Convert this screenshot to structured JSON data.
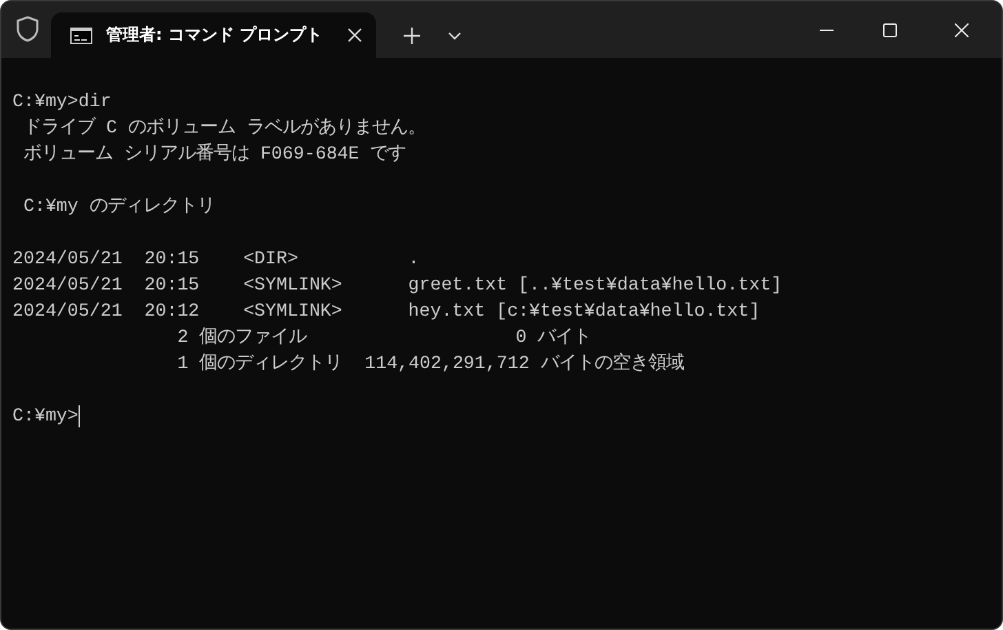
{
  "tab": {
    "title": "管理者: コマンド プロンプト",
    "selected": true
  },
  "console": {
    "lines": [
      {
        "kind": "blank"
      },
      {
        "kind": "text",
        "text": "C:¥my>dir"
      },
      {
        "kind": "text",
        "text": " ドライブ C のボリューム ラベルがありません。"
      },
      {
        "kind": "text",
        "text": " ボリューム シリアル番号は F069-684E です"
      },
      {
        "kind": "blank"
      },
      {
        "kind": "text",
        "text": " C:¥my のディレクトリ"
      },
      {
        "kind": "blank"
      },
      {
        "kind": "text",
        "text": "2024/05/21  20:15    <DIR>          ."
      },
      {
        "kind": "text",
        "text": "2024/05/21  20:15    <SYMLINK>      greet.txt [..¥test¥data¥hello.txt]"
      },
      {
        "kind": "text",
        "text": "2024/05/21  20:12    <SYMLINK>      hey.txt [c:¥test¥data¥hello.txt]"
      },
      {
        "kind": "text",
        "text": "               2 個のファイル                   0 バイト"
      },
      {
        "kind": "text",
        "text": "               1 個のディレクトリ  114,402,291,712 バイトの空き領域"
      },
      {
        "kind": "blank"
      },
      {
        "kind": "prompt",
        "text": "C:¥my>"
      }
    ]
  }
}
